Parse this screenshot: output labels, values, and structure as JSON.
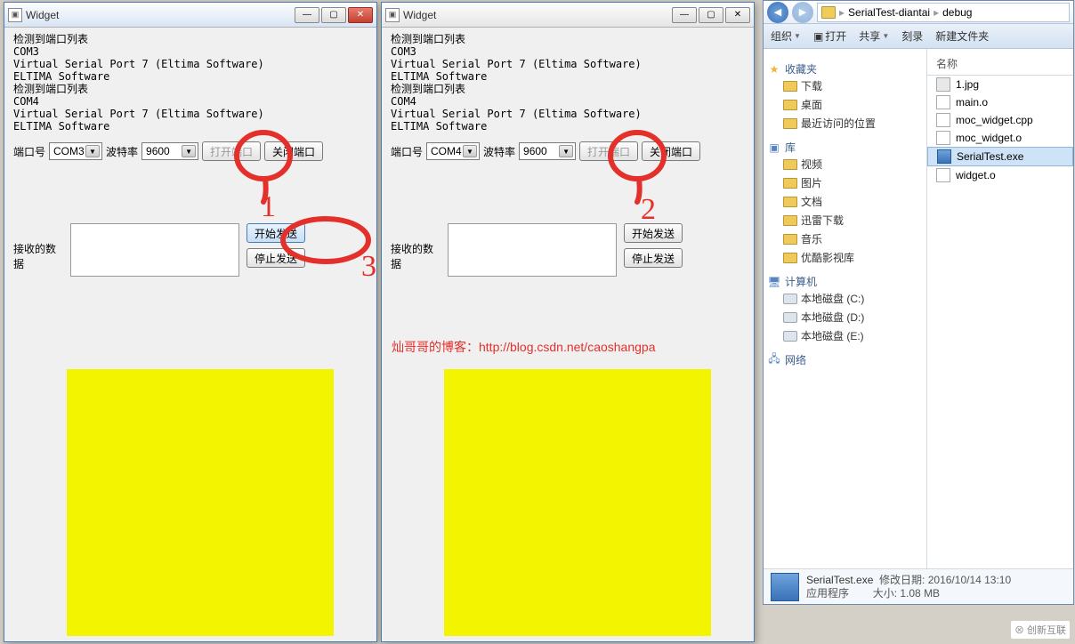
{
  "widget1": {
    "title": "Widget",
    "lines": [
      "检测到端口列表",
      "COM3",
      "Virtual Serial Port 7 (Eltima Software)",
      "ELTIMA Software",
      "检测到端口列表",
      "COM4",
      "Virtual Serial Port 7 (Eltima Software)",
      "ELTIMA Software"
    ],
    "port_label": "端口号",
    "port_value": "COM3",
    "baud_label": "波特率",
    "baud_value": "9600",
    "open_btn": "打开端口",
    "close_btn": "关闭端口",
    "recv_label": "接收的数据",
    "start_btn": "开始发送",
    "stop_btn": "停止发送"
  },
  "widget2": {
    "title": "Widget",
    "lines": [
      "检测到端口列表",
      "COM3",
      "Virtual Serial Port 7 (Eltima Software)",
      "ELTIMA Software",
      "检测到端口列表",
      "COM4",
      "Virtual Serial Port 7 (Eltima Software)",
      "ELTIMA Software"
    ],
    "port_label": "端口号",
    "port_value": "COM4",
    "baud_label": "波特率",
    "baud_value": "9600",
    "open_btn": "打开端口",
    "close_btn": "关闭端口",
    "recv_label": "接收的数据",
    "start_btn": "开始发送",
    "stop_btn": "停止发送"
  },
  "explorer": {
    "breadcrumb": [
      "SerialTest-diantai",
      "debug"
    ],
    "toolbar": {
      "org": "组织",
      "open": "打开",
      "share": "共享",
      "burn": "刻录",
      "newfolder": "新建文件夹"
    },
    "tree": {
      "fav_head": "收藏夹",
      "fav": [
        "下载",
        "桌面",
        "最近访问的位置"
      ],
      "lib_head": "库",
      "lib": [
        "视频",
        "图片",
        "文档",
        "迅雷下载",
        "音乐",
        "优酷影视库"
      ],
      "comp_head": "计算机",
      "comp": [
        "本地磁盘 (C:)",
        "本地磁盘 (D:)",
        "本地磁盘 (E:)"
      ],
      "net_head": "网络"
    },
    "col_name": "名称",
    "files": [
      {
        "name": "1.jpg",
        "type": "img"
      },
      {
        "name": "main.o",
        "type": "o"
      },
      {
        "name": "moc_widget.cpp",
        "type": "cpp"
      },
      {
        "name": "moc_widget.o",
        "type": "o"
      },
      {
        "name": "SerialTest.exe",
        "type": "exe",
        "selected": true
      },
      {
        "name": "widget.o",
        "type": "o"
      }
    ],
    "status": {
      "name": "SerialTest.exe",
      "kind": "应用程序",
      "date_label": "修改日期:",
      "date": "2016/10/14 13:10",
      "size_label": "大小:",
      "size": "1.08 MB"
    }
  },
  "blog_text": "灿哥哥的博客：http://blog.csdn.net/caoshangpa",
  "watermark": "创新互联"
}
